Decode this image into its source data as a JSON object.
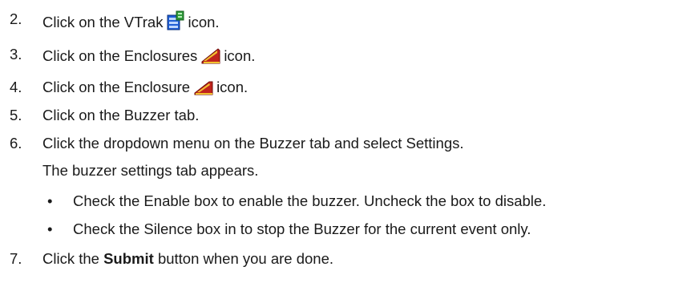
{
  "steps": [
    {
      "num": "2.",
      "before": "Click on the VTrak",
      "icon": "vtrak-icon",
      "after": "icon."
    },
    {
      "num": "3.",
      "before": "Click on the Enclosures",
      "icon": "enclosures-icon",
      "after": "icon."
    },
    {
      "num": "4.",
      "before": "Click on the Enclosure",
      "icon": "enclosure-icon",
      "after": "icon."
    },
    {
      "num": "5.",
      "text": "Click on the Buzzer tab."
    },
    {
      "num": "6.",
      "text": "Click the dropdown menu on the Buzzer tab and select Settings."
    },
    {
      "num": "7.",
      "before": "Click the",
      "bold": "Submit",
      "after": "button when you are done."
    }
  ],
  "note": "The buzzer settings tab appears.",
  "bullet_char": "•",
  "bullets": [
    "Check the Enable box to enable the buzzer. Uncheck the box to disable.",
    "Check the Silence box in to stop the Buzzer for the current event only."
  ],
  "colors": {
    "text": "#1a1a1a",
    "vtrak_icon_blue": "#1f5fd6",
    "vtrak_icon_green": "#2f9a3a",
    "enclosure_red": "#c0241e",
    "enclosure_yellow": "#f2c230"
  }
}
